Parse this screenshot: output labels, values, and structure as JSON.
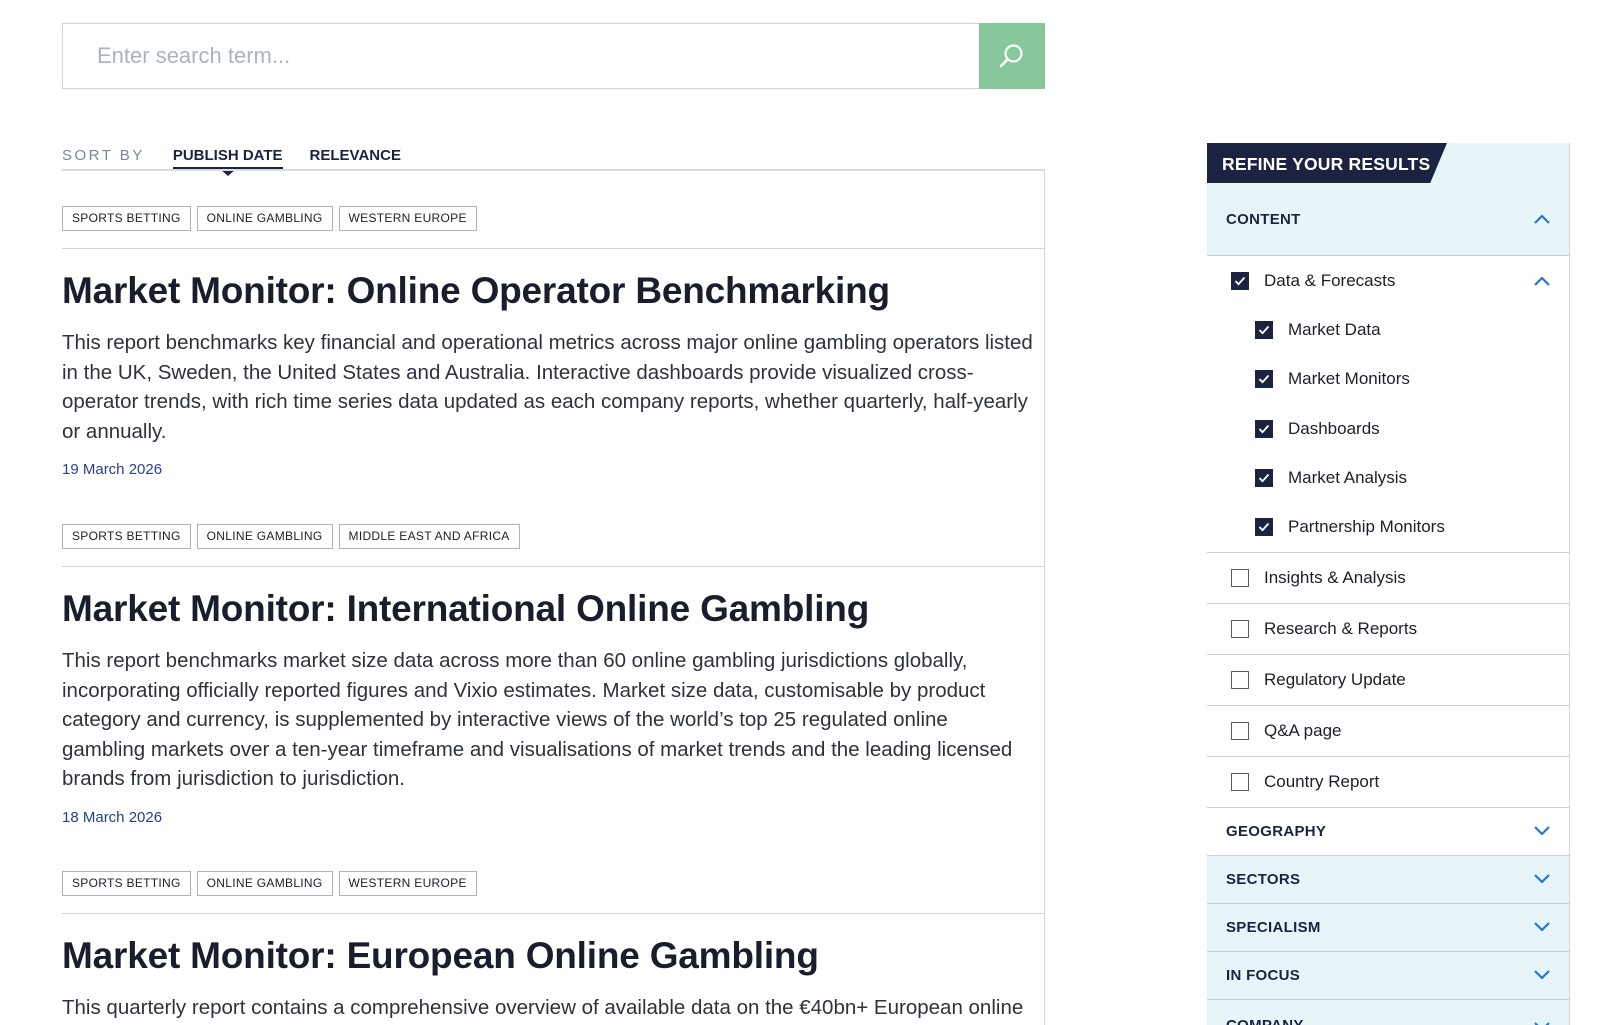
{
  "search": {
    "placeholder": "Enter search term...",
    "button_icon": "search-icon"
  },
  "sort": {
    "label": "SORT BY",
    "options": [
      "PUBLISH DATE",
      "RELEVANCE"
    ],
    "active": "PUBLISH DATE"
  },
  "results": [
    {
      "tags": [
        "SPORTS BETTING",
        "ONLINE GAMBLING",
        "WESTERN EUROPE"
      ],
      "title": "Market Monitor: Online Operator Benchmarking",
      "description": "This report benchmarks key financial and operational metrics across major online gambling operators listed in the UK, Sweden, the United States and Australia. Interactive dashboards provide visualized cross-operator trends, with rich time series data updated as each company reports, whether quarterly, half-yearly or annually.",
      "date": "19 March 2026"
    },
    {
      "tags": [
        "SPORTS BETTING",
        "ONLINE GAMBLING",
        "MIDDLE EAST AND AFRICA"
      ],
      "title": "Market Monitor: International Online Gambling",
      "description": "This report benchmarks market size data across more than 60 online gambling jurisdictions globally, incorporating officially reported figures and Vixio estimates. Market size data, customisable by product category and currency, is supplemented by interactive views of the world’s top 25 regulated online gambling markets over a ten-year timeframe and visualisations of market trends and the leading licensed brands from jurisdiction to jurisdiction.",
      "date": "18 March 2026"
    },
    {
      "tags": [
        "SPORTS BETTING",
        "ONLINE GAMBLING",
        "WESTERN EUROPE"
      ],
      "title": "Market Monitor: European Online Gambling",
      "description": "This quarterly report contains a comprehensive overview of available data on the €40bn+ European online",
      "date": ""
    }
  ],
  "sidebar": {
    "title": "REFINE YOUR RESULTS",
    "content_section": {
      "label": "CONTENT",
      "parent": {
        "label": "Data & Forecasts",
        "checked": true
      },
      "children": [
        {
          "label": "Market Data",
          "checked": true
        },
        {
          "label": "Market Monitors",
          "checked": true
        },
        {
          "label": "Dashboards",
          "checked": true
        },
        {
          "label": "Market Analysis",
          "checked": true
        },
        {
          "label": "Partnership Monitors",
          "checked": true
        }
      ],
      "others": [
        {
          "label": "Insights & Analysis",
          "checked": false
        },
        {
          "label": "Research & Reports",
          "checked": false
        },
        {
          "label": "Regulatory Update",
          "checked": false
        },
        {
          "label": "Q&A page",
          "checked": false
        },
        {
          "label": "Country Report",
          "checked": false
        }
      ]
    },
    "sections": [
      "GEOGRAPHY",
      "SECTORS",
      "SPECIALISM",
      "IN FOCUS",
      "COMPANY"
    ]
  },
  "colors": {
    "accent_green": "#86c79c",
    "navy": "#1c2340",
    "date_blue": "#27408b",
    "sidebar_bg": "#e8f5f8",
    "chevron_blue": "#2677c9"
  }
}
